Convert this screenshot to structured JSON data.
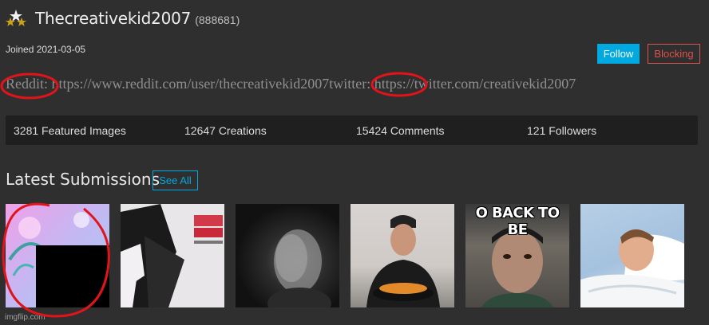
{
  "profile": {
    "username": "Thecreativekid2007",
    "points": "(888681)",
    "rank_icon": "rank-stars-icon",
    "joined": "Joined 2021-03-05"
  },
  "actions": {
    "follow_label": "Follow",
    "blocking_label": "Blocking"
  },
  "bio": {
    "reddit_label": "Reddit:",
    "reddit_url": "https://www.reddit.com/user/thecreativekid2007",
    "twitter_label": "twitter:",
    "twitter_url": "https://twitter.com/creativekid2007"
  },
  "stats": [
    {
      "label": "3281 Featured Images"
    },
    {
      "label": "12647 Creations"
    },
    {
      "label": "15424 Comments"
    },
    {
      "label": "121 Followers"
    }
  ],
  "latest": {
    "title": "Latest Submissions",
    "see_all_label": "See All",
    "thumbnails": [
      {
        "name": "submission-thumb-1"
      },
      {
        "name": "submission-thumb-2"
      },
      {
        "name": "submission-thumb-3"
      },
      {
        "name": "submission-thumb-4"
      },
      {
        "name": "submission-thumb-5",
        "caption": "O BACK TO BE"
      },
      {
        "name": "submission-thumb-6"
      }
    ]
  },
  "watermark": "imgflip.com",
  "colors": {
    "background": "#2f2f2f",
    "accent": "#00a9e0",
    "danger": "#d9534f",
    "annotation_red": "#e0141a"
  }
}
